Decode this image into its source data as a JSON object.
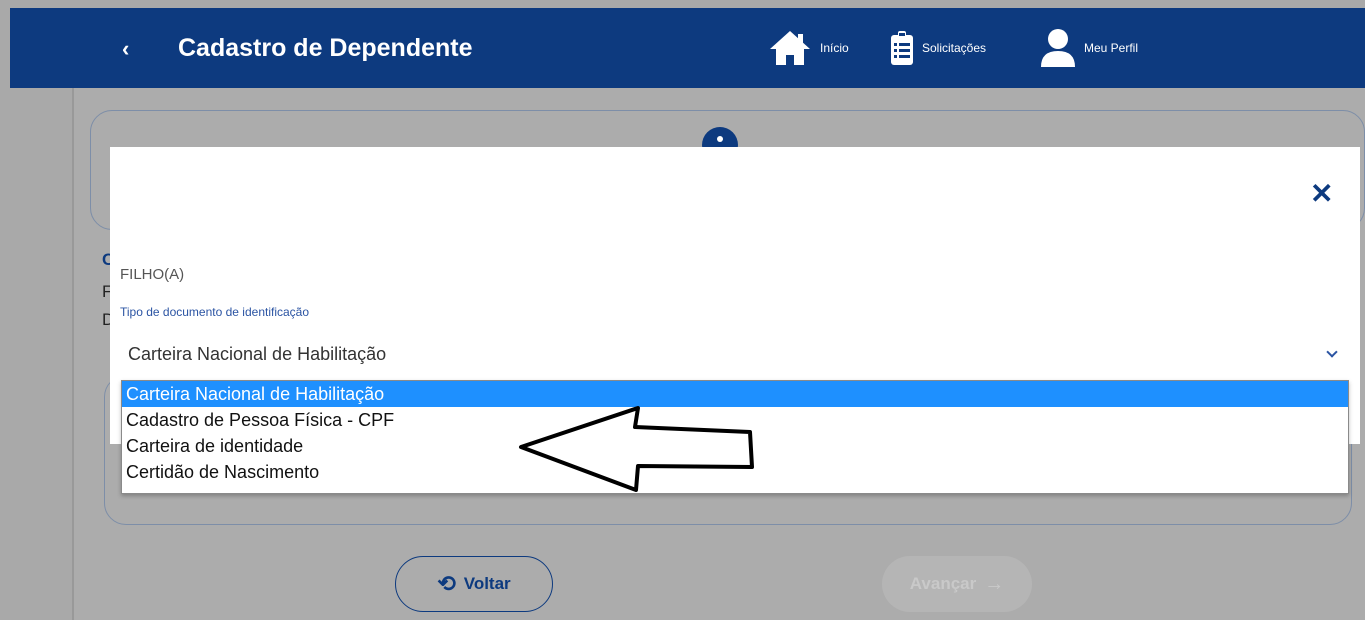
{
  "header": {
    "back_icon": "‹",
    "title": "Cadastro de Dependente",
    "nav": [
      {
        "label": "Início",
        "icon": "home-icon"
      },
      {
        "label": "Solicitações",
        "icon": "clipboard-icon"
      },
      {
        "label": "Meu Perfil",
        "icon": "user-icon"
      }
    ]
  },
  "background": {
    "letters": [
      "C",
      "F",
      "D"
    ]
  },
  "modal": {
    "close_icon": "✕",
    "relation": "FILHO(A)",
    "field_label": "Tipo de documento de identificação",
    "selected": "Carteira Nacional de Habilitação",
    "options": [
      "Carteira Nacional de Habilitação",
      "Cadastro de Pessoa Física - CPF",
      "Carteira de identidade",
      "Certidão de Nascimento"
    ]
  },
  "footer": {
    "back_label": "Voltar",
    "next_label": "Avançar"
  },
  "colors": {
    "primary": "#0d3a7f",
    "highlight": "#1e90ff",
    "overlay": "#a9a9a9"
  }
}
